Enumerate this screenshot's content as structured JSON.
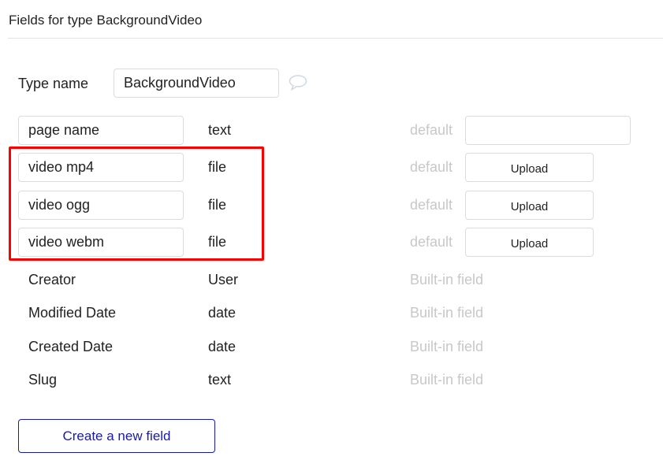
{
  "header": {
    "title": "Fields for type BackgroundVideo"
  },
  "type_name": {
    "label": "Type name",
    "value": "BackgroundVideo",
    "comment_icon": "speech-bubble-icon"
  },
  "custom_fields": [
    {
      "name": "page name",
      "type": "text",
      "default_label": "default",
      "default_control": "text-input",
      "default_value": ""
    },
    {
      "name": "video mp4",
      "type": "file",
      "default_label": "default",
      "default_control": "upload",
      "upload_label": "Upload"
    },
    {
      "name": "video ogg",
      "type": "file",
      "default_label": "default",
      "default_control": "upload",
      "upload_label": "Upload"
    },
    {
      "name": "video webm",
      "type": "file",
      "default_label": "default",
      "default_control": "upload",
      "upload_label": "Upload"
    }
  ],
  "builtin_fields": [
    {
      "name": "Creator",
      "type": "User",
      "note": "Built-in field"
    },
    {
      "name": "Modified Date",
      "type": "date",
      "note": "Built-in field"
    },
    {
      "name": "Created Date",
      "type": "date",
      "note": "Built-in field"
    },
    {
      "name": "Slug",
      "type": "text",
      "note": "Built-in field"
    }
  ],
  "actions": {
    "create_field_label": "Create a new field"
  },
  "colors": {
    "highlight": "#ff0000",
    "accent": "#1a1aa6",
    "muted": "#c8c8c8"
  }
}
